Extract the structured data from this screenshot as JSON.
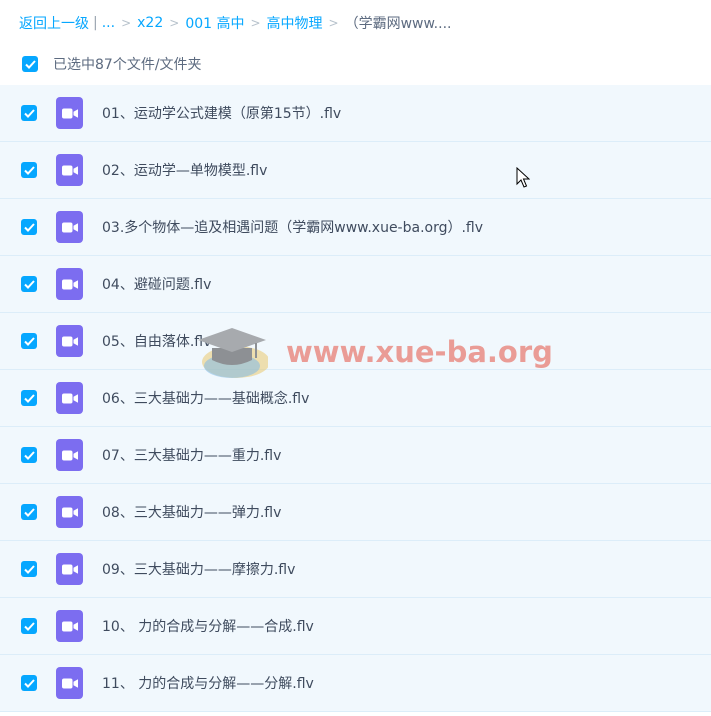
{
  "breadcrumb": {
    "back": "返回上一级",
    "divider": "|",
    "ellipsis": "...",
    "sep": ">",
    "items": [
      "x22",
      "001 高中",
      "高中物理"
    ],
    "current": "（学霸网www...."
  },
  "selection": {
    "summary": "已选中87个文件/文件夹",
    "checked": true
  },
  "files": [
    {
      "name": "01、运动学公式建模（原第15节）.flv",
      "checked": true
    },
    {
      "name": "02、运动学—单物模型.flv",
      "checked": true
    },
    {
      "name": "03.多个物体—追及相遇问题（学霸网www.xue-ba.org）.flv",
      "checked": true
    },
    {
      "name": "04、避碰问题.flv",
      "checked": true
    },
    {
      "name": "05、自由落体.flv",
      "checked": true
    },
    {
      "name": "06、三大基础力——基础概念.flv",
      "checked": true
    },
    {
      "name": "07、三大基础力——重力.flv",
      "checked": true
    },
    {
      "name": "08、三大基础力——弹力.flv",
      "checked": true
    },
    {
      "name": "09、三大基础力——摩擦力.flv",
      "checked": true
    },
    {
      "name": "10、 力的合成与分解——合成.flv",
      "checked": true
    },
    {
      "name": "11、 力的合成与分解——分解.flv",
      "checked": true
    }
  ],
  "watermark": {
    "text": "www.xue-ba.org"
  },
  "icons": {
    "file": "video-file-icon",
    "check": "check-icon",
    "cursor": "mouse-cursor-icon"
  },
  "colors": {
    "accent": "#06a7ff",
    "video_icon": "#7c6df0",
    "row_bg": "#f1f8fd",
    "watermark": "#e8786e"
  }
}
